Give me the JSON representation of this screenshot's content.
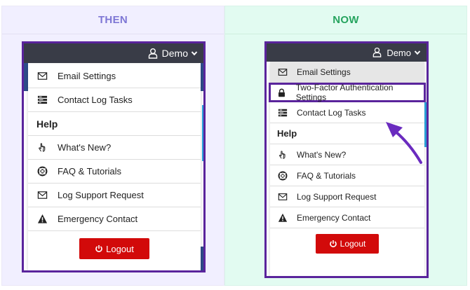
{
  "then": {
    "heading": "THEN",
    "user": "Demo",
    "items": [
      {
        "label": "Email Settings",
        "icon": "envelope-icon"
      },
      {
        "label": "Contact Log Tasks",
        "icon": "tasks-icon"
      },
      {
        "label": "Help",
        "icon": "",
        "section": true
      },
      {
        "label": "What's New?",
        "icon": "pointer-hand-icon"
      },
      {
        "label": "FAQ & Tutorials",
        "icon": "lifebuoy-icon"
      },
      {
        "label": "Log Support Request",
        "icon": "envelope-icon"
      },
      {
        "label": "Emergency Contact",
        "icon": "warning-icon"
      }
    ],
    "logout": "Logout"
  },
  "now": {
    "heading": "NOW",
    "user": "Demo",
    "items": [
      {
        "label": "Email Settings",
        "icon": "envelope-icon"
      },
      {
        "label": "Two-Factor Authentication Settings",
        "icon": "lock-icon",
        "highlight": true
      },
      {
        "label": "Contact Log Tasks",
        "icon": "tasks-icon"
      },
      {
        "label": "Help",
        "icon": "",
        "section": true
      },
      {
        "label": "What's New?",
        "icon": "pointer-hand-icon"
      },
      {
        "label": "FAQ & Tutorials",
        "icon": "lifebuoy-icon"
      },
      {
        "label": "Log Support Request",
        "icon": "envelope-icon"
      },
      {
        "label": "Emergency Contact",
        "icon": "warning-icon"
      }
    ],
    "logout": "Logout"
  },
  "colors": {
    "then_heading": "#7e77d5",
    "now_heading": "#26a45f",
    "frame": "#5a249c",
    "logout": "#d20a0a",
    "topbar": "#393c47"
  }
}
